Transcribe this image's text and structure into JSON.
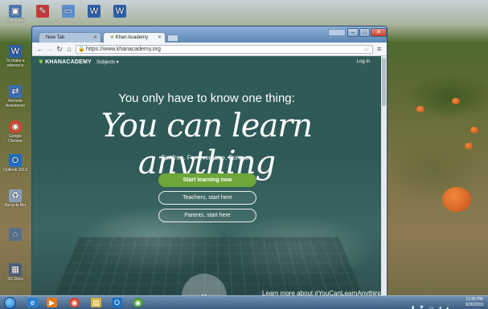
{
  "desktop": {
    "icons": [
      {
        "label": "Computer",
        "icon": "computer-icon"
      },
      {
        "label": "",
        "icon": "scanner-icon"
      },
      {
        "label": "",
        "icon": "word-doc-icon"
      },
      {
        "label": "",
        "icon": "word-doc-icon"
      },
      {
        "label": "",
        "icon": "word-doc-icon"
      },
      {
        "label": "To make a reference",
        "icon": "word-doc-icon"
      },
      {
        "label": "Remote Assistance",
        "icon": "remote-icon"
      },
      {
        "label": "Google Chrome",
        "icon": "chrome-icon"
      },
      {
        "label": "Outlook 2013",
        "icon": "outlook-icon"
      },
      {
        "label": "Recycle Bin",
        "icon": "recycle-bin-icon"
      },
      {
        "label": "",
        "icon": "network-icon"
      },
      {
        "label": "SC Docs",
        "icon": "folder-icon"
      }
    ]
  },
  "browser": {
    "tabs": [
      {
        "label": "New Tab"
      },
      {
        "label": "Khan Academy"
      }
    ],
    "url": "https://www.khanacademy.org",
    "user_badge": "",
    "window_buttons": {
      "minimize": "–",
      "maximize": "□",
      "close": "✕"
    }
  },
  "page": {
    "logo": "KHANACADEMY",
    "subjects": "Subjects ▾",
    "login": "Log in",
    "headline": "You only have to know one thing:",
    "big_headline": "You can learn anything",
    "tagline": "For free. For everyone. Forever.",
    "cta_start": "Start learning now",
    "cta_teachers": "Teachers, start here",
    "cta_parents": "Parents, start here",
    "learn_more": "Learn more about #YouCanLearnAnything",
    "scroll_glyph": "⌄"
  },
  "taskbar": {
    "apps": [
      {
        "icon": "ie-icon",
        "glyph": "e",
        "color": "#2a7fd4"
      },
      {
        "icon": "media-player-icon",
        "glyph": "▶",
        "color": "#e07b1a"
      },
      {
        "icon": "chrome-icon",
        "glyph": "◉",
        "color": "#d9452c"
      },
      {
        "icon": "explorer-icon",
        "glyph": "▤",
        "color": "#d9b43a"
      },
      {
        "icon": "outlook-icon",
        "glyph": "O",
        "color": "#1d6fbf"
      },
      {
        "icon": "chrome-icon",
        "glyph": "◉",
        "color": "#4a9d3c"
      }
    ],
    "clock_time": "12:36 PM",
    "clock_date": "9/26/2015"
  }
}
